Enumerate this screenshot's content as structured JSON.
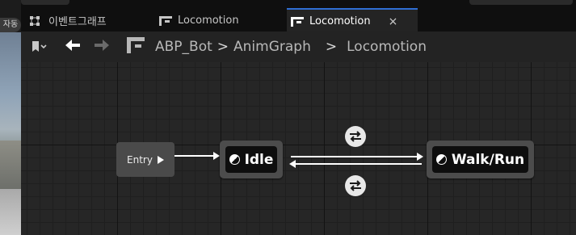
{
  "left_strip": {
    "badge_label": "자동"
  },
  "tabs": [
    {
      "label": "이벤트그래프",
      "icon": "event-graph-icon",
      "active": false
    },
    {
      "label": "Locomotion",
      "icon": "state-machine-icon",
      "active": false
    },
    {
      "label": "Locomotion",
      "icon": "state-machine-icon",
      "active": true,
      "close": "×"
    }
  ],
  "breadcrumb": {
    "items": [
      "ABP_Bot",
      "AnimGraph",
      "Locomotion"
    ],
    "separator": ">"
  },
  "graph": {
    "entry_label": "Entry",
    "states": [
      "Idle",
      "Walk/Run"
    ]
  },
  "colors": {
    "active_tab_accent": "#2f6ed3",
    "canvas": "#262626",
    "node": "#4c4c4c"
  }
}
